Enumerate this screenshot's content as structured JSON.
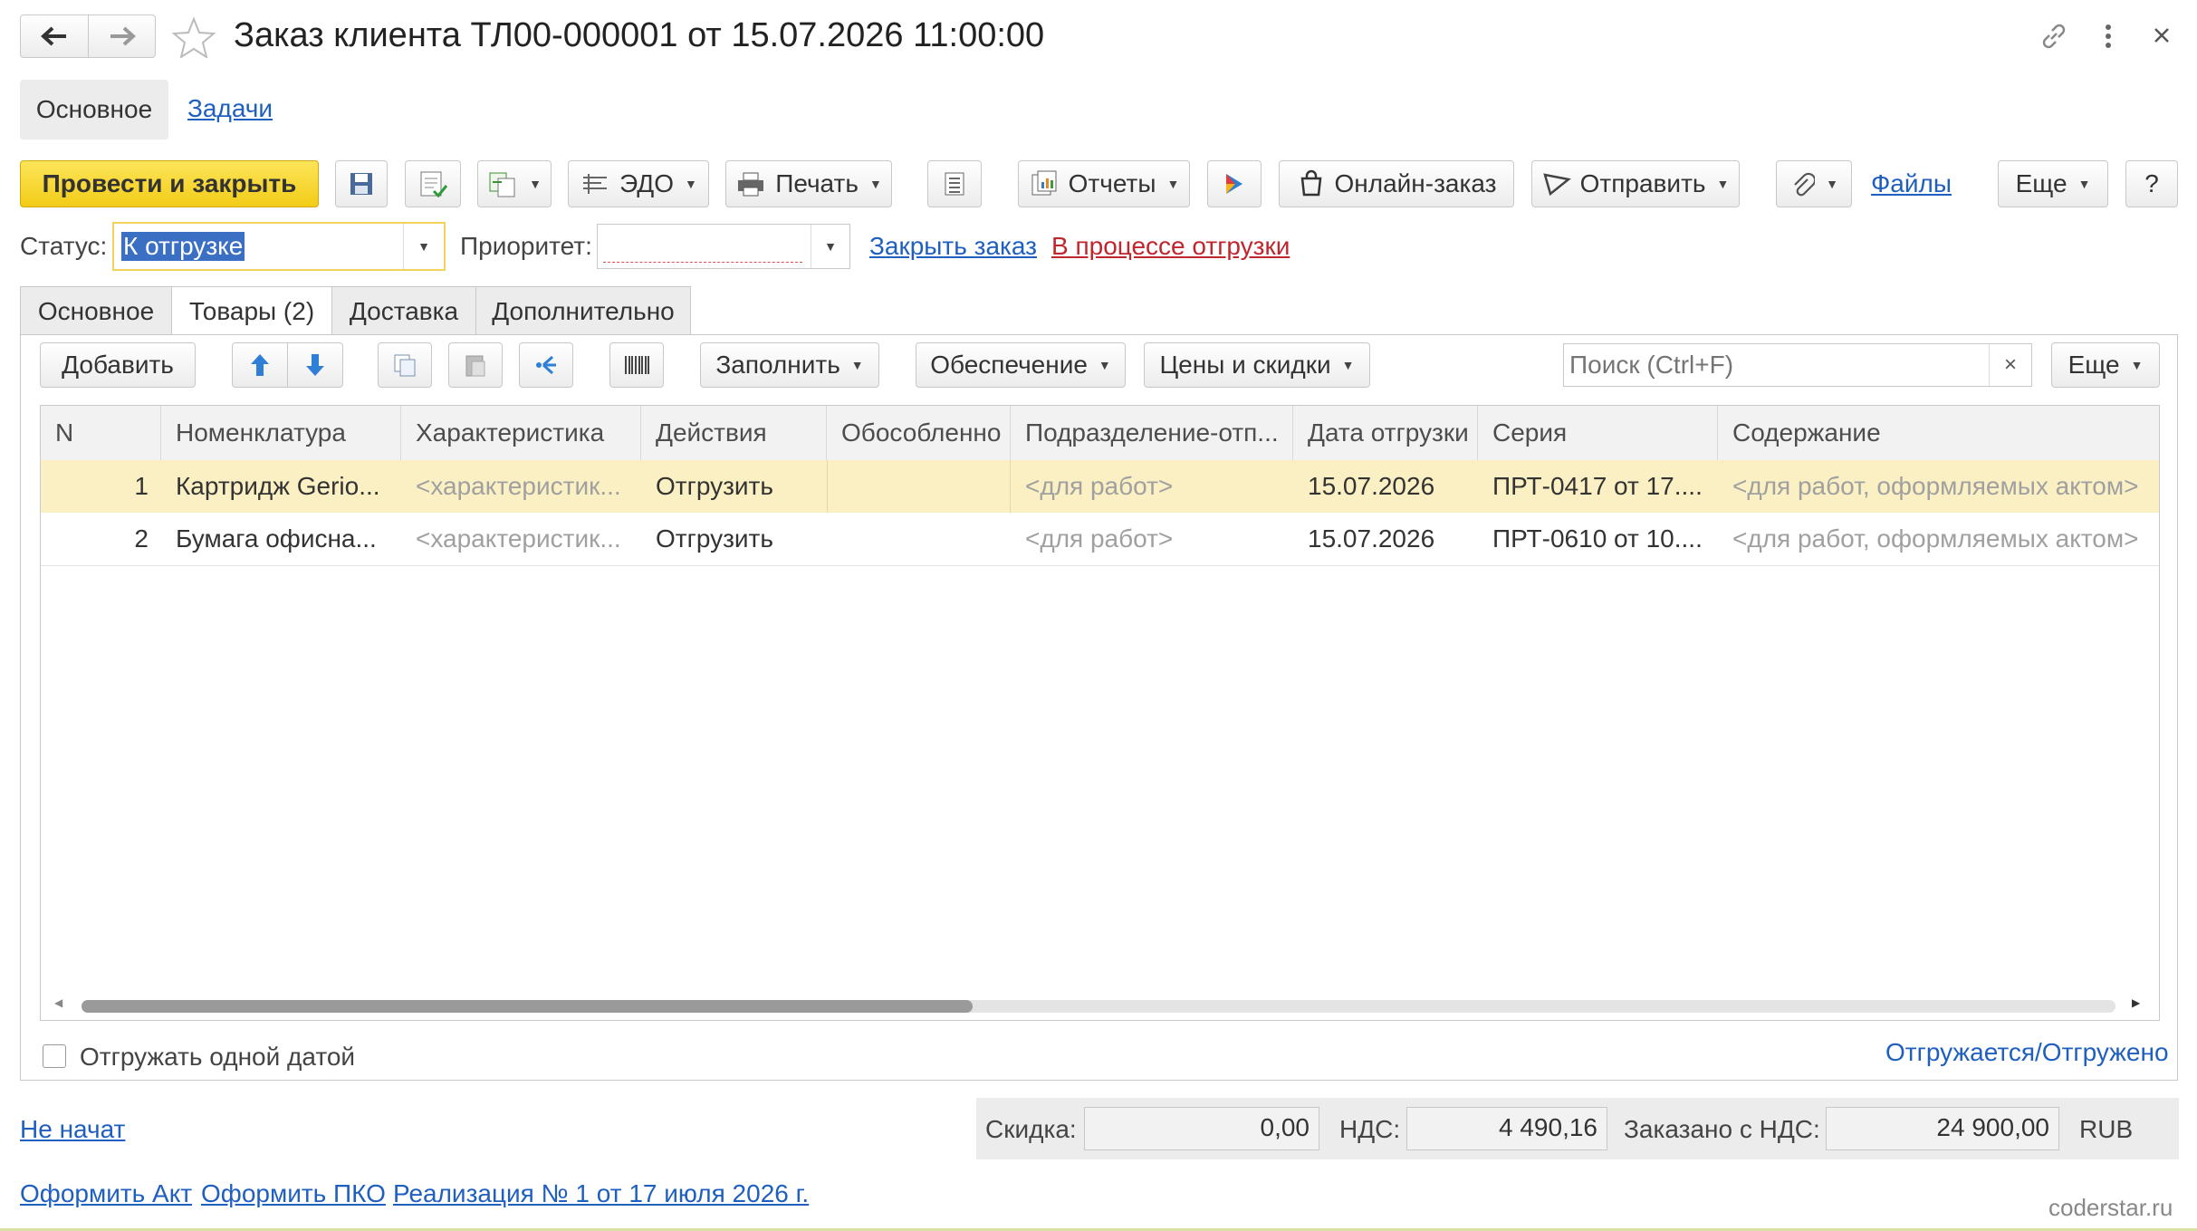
{
  "window": {
    "title": "Заказ клиента ТЛ00-000001 от 15.07.2026 11:00:00"
  },
  "nav": {
    "main_label": "Основное",
    "tasks_label": "Задачи"
  },
  "toolbar": {
    "post_close": "Провести и закрыть",
    "edo": "ЭДО",
    "print": "Печать",
    "reports": "Отчеты",
    "online_order": "Онлайн-заказ",
    "send": "Отправить",
    "files": "Файлы",
    "more": "Еще",
    "help": "?"
  },
  "status_row": {
    "status_label": "Статус:",
    "status_value": "К отгрузке",
    "priority_label": "Приоритет:",
    "priority_value": "",
    "close_order": "Закрыть заказ",
    "in_progress": "В процессе отгрузки"
  },
  "tabs": [
    {
      "label": "Основное"
    },
    {
      "label": "Товары (2)"
    },
    {
      "label": "Доставка"
    },
    {
      "label": "Дополнительно"
    }
  ],
  "goods_toolbar": {
    "add": "Добавить",
    "fill": "Заполнить",
    "supply": "Обеспечение",
    "prices": "Цены и скидки",
    "search_placeholder": "Поиск (Ctrl+F)",
    "more": "Еще"
  },
  "table": {
    "columns": [
      "N",
      "Номенклатура",
      "Характеристика",
      "Действия",
      "Обособленно",
      "Подразделение-отп...",
      "Дата отгрузки",
      "Серия",
      "Содержание"
    ],
    "rows": [
      {
        "n": "1",
        "item": "Картридж Gerio...",
        "characteristic": "<характеристик...",
        "action": "Отгрузить",
        "separate": "",
        "division": "<для работ>",
        "date": "15.07.2026",
        "series": "ПРТ-0417 от 17....",
        "content": "<для работ, оформляемых актом>"
      },
      {
        "n": "2",
        "item": "Бумага офисна...",
        "characteristic": "<характеристик...",
        "action": "Отгрузить",
        "separate": "",
        "division": "<для работ>",
        "date": "15.07.2026",
        "series": "ПРТ-0610 от 10....",
        "content": "<для работ, оформляемых актом>"
      }
    ]
  },
  "footer": {
    "ship_one_date": "Отгружать одной датой",
    "shipped_link": "Отгружается/Отгружено",
    "not_started": "Не начат",
    "discount_label": "Скидка:",
    "discount_value": "0,00",
    "vat_label": "НДС:",
    "vat_value": "4 490,16",
    "ordered_label": "Заказано с НДС:",
    "ordered_value": "24 900,00",
    "currency": "RUB",
    "act_link": "Оформить Акт",
    "pko_link": "Оформить ПКО",
    "realization_link": "Реализация № 1 от 17 июля 2026 г.",
    "watermark": "coderstar.ru"
  },
  "colors": {
    "accent_yellow": "#f5d21a",
    "selected_row": "#fbf0c3",
    "link": "#1f5fbf",
    "link_red": "#c0262d"
  }
}
